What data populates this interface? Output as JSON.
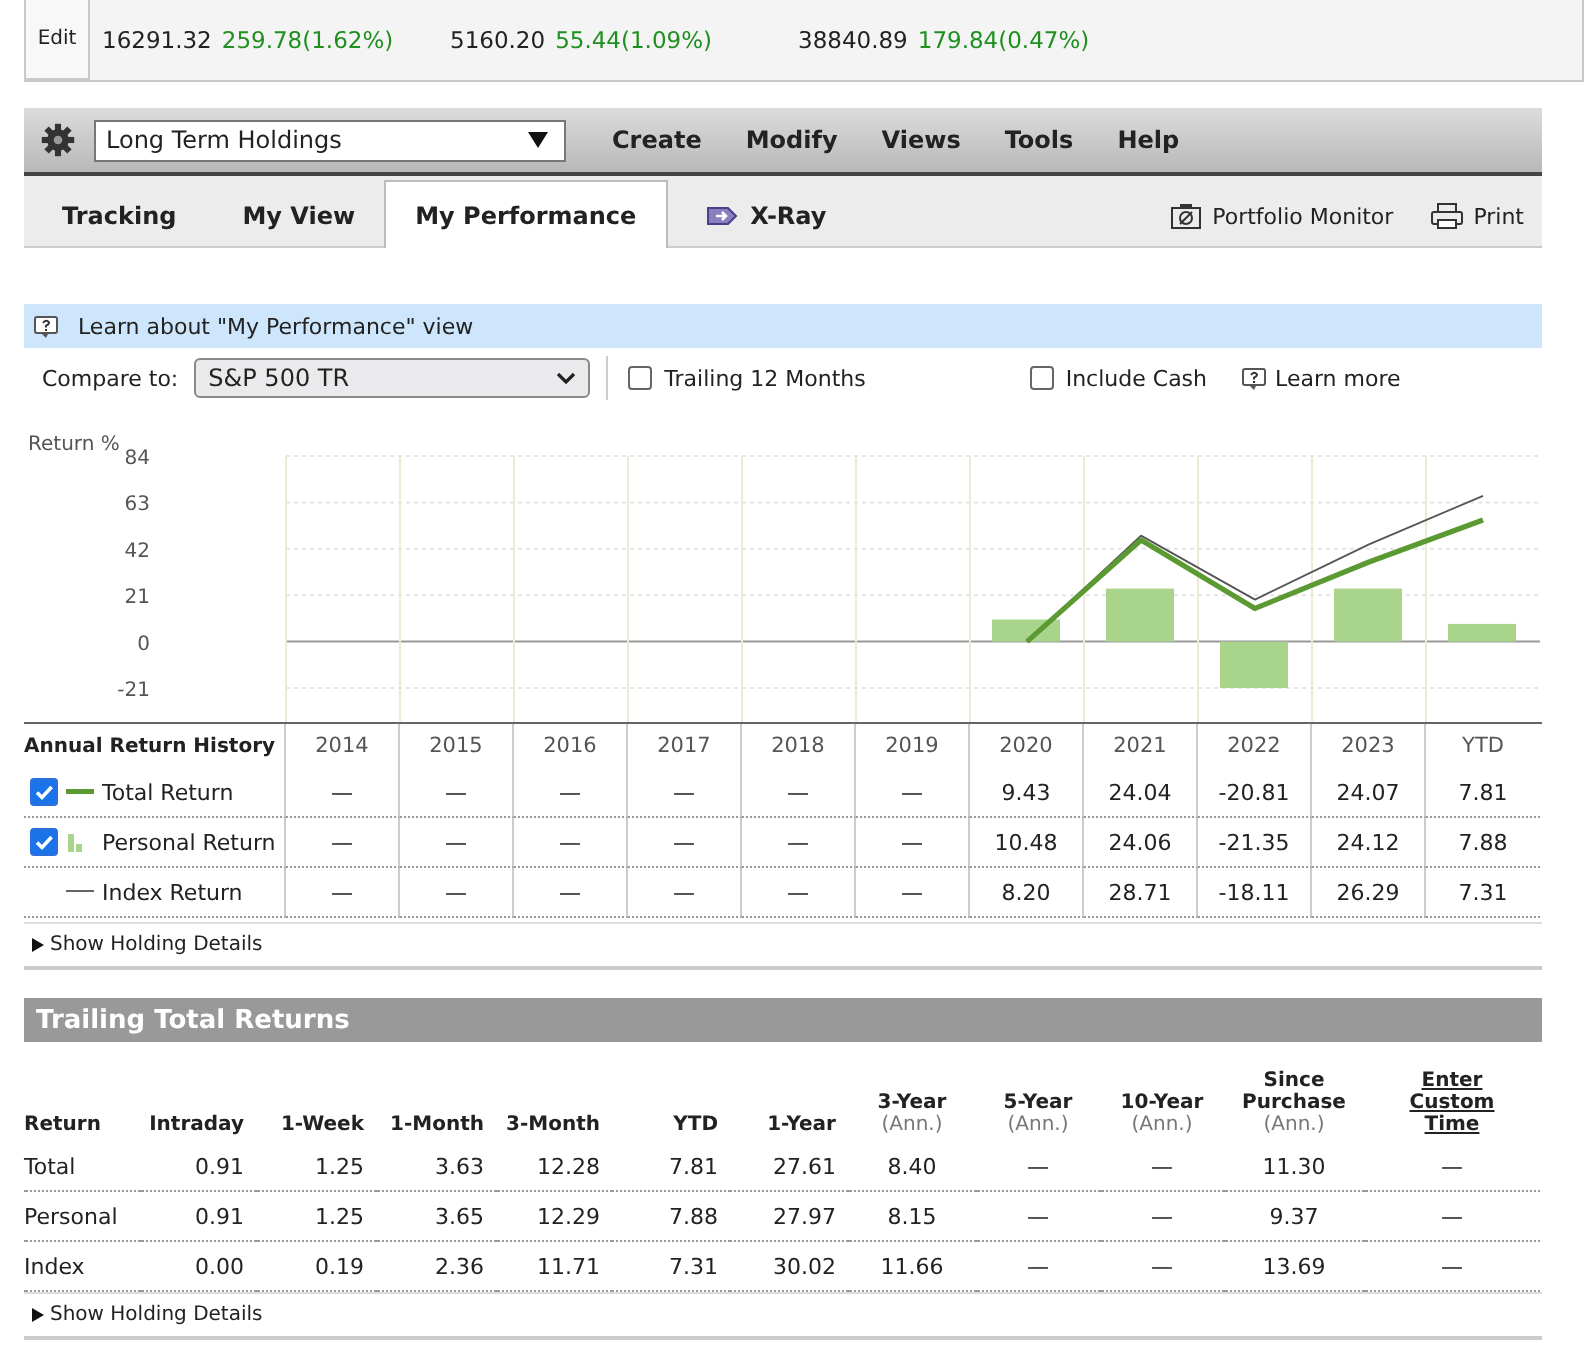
{
  "ticker": {
    "edit_label": "Edit",
    "items": [
      {
        "value": "16291.32",
        "change": "259.78(1.62%)"
      },
      {
        "value": "5160.20",
        "change": "55.44(1.09%)"
      },
      {
        "value": "38840.89",
        "change": "179.84(0.47%)"
      }
    ]
  },
  "toolbar": {
    "portfolio": "Long Term Holdings",
    "menus": [
      "Create",
      "Modify",
      "Views",
      "Tools",
      "Help"
    ]
  },
  "tabs": [
    {
      "label": "Tracking",
      "selected": false,
      "kind": "plain"
    },
    {
      "label": "My View",
      "selected": false,
      "kind": "plain"
    },
    {
      "label": "My Performance",
      "selected": true,
      "kind": "plain"
    },
    {
      "label": "X-Ray",
      "selected": false,
      "kind": "xray"
    }
  ],
  "tab_actions": [
    {
      "label": "Portfolio Monitor",
      "kind": "monitor"
    },
    {
      "label": "Print",
      "kind": "print"
    }
  ],
  "info_bar": "Learn about \"My Performance\" view",
  "options": {
    "compare_label": "Compare to:",
    "compare_value": "S&P 500 TR",
    "trailing_12": {
      "label": "Trailing 12 Months",
      "checked": false
    },
    "include_cash": {
      "label": "Include Cash",
      "checked": false
    },
    "learn_more": "Learn more"
  },
  "chart": {
    "chart_data": {
      "type": "bar",
      "ylabel": "Return %",
      "grid": true,
      "categories": [
        "2014",
        "2015",
        "2016",
        "2017",
        "2018",
        "2019",
        "2020",
        "2021",
        "2022",
        "2023",
        "YTD"
      ],
      "series": [
        {
          "color": "#a9d48c",
          "values": [
            null,
            null,
            null,
            null,
            null,
            null,
            10,
            24,
            -21,
            24,
            8
          ]
        },
        {
          "type": "line",
          "color": "#555555",
          "values": [
            null,
            null,
            null,
            null,
            null,
            null,
            0,
            48,
            19,
            44,
            66
          ]
        },
        {
          "type": "line",
          "color": "#5b9a32",
          "values": [
            null,
            null,
            null,
            null,
            null,
            null,
            0,
            46,
            15,
            36,
            55
          ]
        }
      ],
      "ylim": [
        -21,
        84
      ],
      "yticks": [
        84,
        63,
        42,
        21,
        0,
        -21
      ]
    }
  },
  "annual": {
    "title": "Annual Return History",
    "rows": [
      {
        "label": "Total Return",
        "kind": "line",
        "checkable": true,
        "checked": true,
        "values": [
          "—",
          "—",
          "—",
          "—",
          "—",
          "—",
          "9.43",
          "24.04",
          "-20.81",
          "24.07",
          "7.81"
        ]
      },
      {
        "label": "Personal Return",
        "kind": "bar",
        "checkable": true,
        "checked": true,
        "values": [
          "—",
          "—",
          "—",
          "—",
          "—",
          "—",
          "10.48",
          "24.06",
          "-21.35",
          "24.12",
          "7.88"
        ]
      },
      {
        "label": "Index Return",
        "kind": "thin-line",
        "checkable": false,
        "values": [
          "—",
          "—",
          "—",
          "—",
          "—",
          "—",
          "8.20",
          "28.71",
          "-18.11",
          "26.29",
          "7.31"
        ]
      }
    ],
    "details_link": "Show Holding Details"
  },
  "trailing": {
    "title": "Trailing Total Returns",
    "columns": [
      {
        "label": "Return",
        "kind": "name"
      },
      {
        "label": "Intraday",
        "kind": "num"
      },
      {
        "label": "1-Week",
        "kind": "num"
      },
      {
        "label": "1-Month",
        "kind": "num"
      },
      {
        "label": "3-Month",
        "kind": "num"
      },
      {
        "label": "YTD",
        "kind": "num"
      },
      {
        "label": "1-Year",
        "kind": "num"
      },
      {
        "label": "3-Year",
        "sub": "(Ann.)",
        "kind": "center"
      },
      {
        "label": "5-Year",
        "sub": "(Ann.)",
        "kind": "center"
      },
      {
        "label": "10-Year",
        "sub": "(Ann.)",
        "kind": "center"
      },
      {
        "label": "Since Purchase",
        "sub": "(Ann.)",
        "kind": "center"
      },
      {
        "label": "Enter Custom Time",
        "kind": "link"
      }
    ],
    "rows": [
      [
        "Total",
        "0.91",
        "1.25",
        "3.63",
        "12.28",
        "7.81",
        "27.61",
        "8.40",
        "—",
        "—",
        "11.30",
        "—"
      ],
      [
        "Personal",
        "0.91",
        "1.25",
        "3.65",
        "12.29",
        "7.88",
        "27.97",
        "8.15",
        "—",
        "—",
        "9.37",
        "—"
      ],
      [
        "Index",
        "0.00",
        "0.19",
        "2.36",
        "11.71",
        "7.31",
        "30.02",
        "11.66",
        "—",
        "—",
        "13.69",
        "—"
      ]
    ],
    "details_link": "Show Holding Details"
  }
}
